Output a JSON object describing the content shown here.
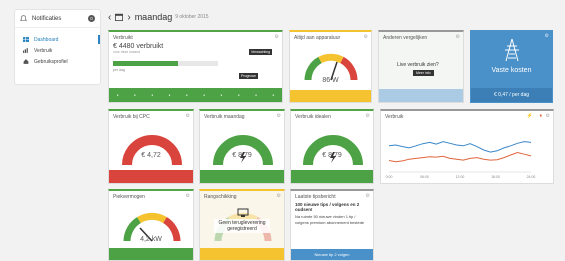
{
  "sidebar": {
    "notifications_label": "Notificaties",
    "notifications_count": "0",
    "items": [
      {
        "label": "Dashboard",
        "active": true
      },
      {
        "label": "Verbruik",
        "active": false
      },
      {
        "label": "Gebruiksprofiel",
        "active": false
      }
    ]
  },
  "header": {
    "day": "maandag",
    "date": "9 oktober 2015"
  },
  "tiles": {
    "verbruikt": {
      "title": "Verbruikt",
      "value": "€ 4480 verbruikt",
      "sub": "voor deze maand",
      "bar_fill": 0.62,
      "tag1": "Verwachting",
      "tag2": "Prognose",
      "footer_label": "per dag"
    },
    "altijd_aan": {
      "title": "Altijd aan apparatuur",
      "value": "86 W",
      "footer": ""
    },
    "anderen": {
      "title": "Anderen vergelijken",
      "overlay": "Live verbruik zien?",
      "overlay_btn": "Meer info",
      "footer": ""
    },
    "vaste_kosten": {
      "title": "",
      "label": "Vaste kosten",
      "footer": "€ 0,47 / per dag"
    },
    "cpc": {
      "title": "Verbruik bij CPC",
      "value": "€ 4,72",
      "footer": ""
    },
    "maandag": {
      "title": "Verbruik maandag",
      "value": "€ 8,79",
      "footer": ""
    },
    "ideaal": {
      "title": "Verbruik idealen",
      "value": "€ 8,79",
      "footer": ""
    },
    "grafiek": {
      "title": "Verbruik"
    },
    "piekvermogen": {
      "title": "Piekvermogen",
      "value": "4,2 kW",
      "footer": ""
    },
    "rangschikking": {
      "title": "Rangschikking",
      "text": "Geen terugleverering geregistreerd",
      "footer": ""
    },
    "tip": {
      "title": "Laatste tipsbericht",
      "headline": "100 nieuwe tips / volgens en 2 oudsen!",
      "body": "Na ruimte 50 nieuwe vinden 1 tip / volgens premium abonnement bestede ",
      "footer": "Nieuwe tip 2 volgen"
    }
  },
  "chart_data": {
    "type": "line",
    "x": [
      "0:00",
      "06:00",
      "12:00",
      "18:00",
      "24:00"
    ],
    "series": [
      {
        "name": "",
        "color": "#3a87c9",
        "values": [
          60,
          62,
          58,
          55,
          60,
          65,
          68,
          64,
          70,
          66,
          62,
          60,
          65,
          58,
          50,
          45,
          48,
          55,
          60,
          66,
          70,
          68
        ]
      },
      {
        "name": "",
        "color": "#e0653b",
        "values": [
          25,
          22,
          24,
          28,
          30,
          32,
          34,
          33,
          35,
          30,
          28,
          26,
          30,
          32,
          28,
          26,
          27,
          32,
          38,
          44,
          40,
          36
        ]
      }
    ],
    "ylim": [
      0,
      100
    ],
    "grid": false
  },
  "colors": {
    "green": "#4ea246",
    "red": "#d9453c",
    "yellow": "#f5c330",
    "blue": "#4a90c9"
  }
}
